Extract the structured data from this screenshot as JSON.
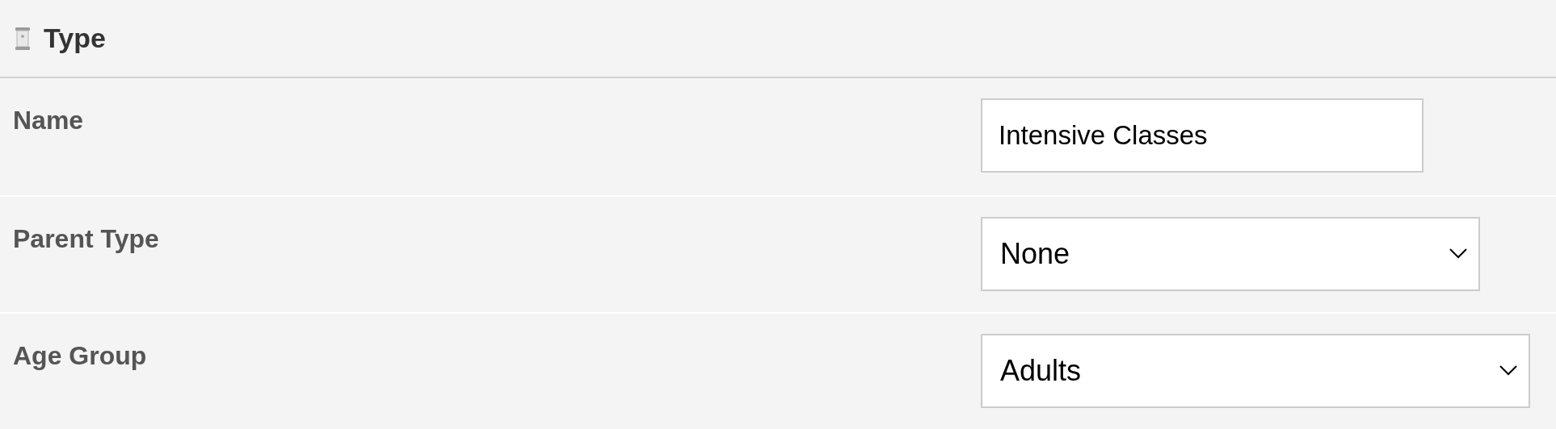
{
  "section": {
    "title": "Type"
  },
  "fields": [
    {
      "label": "Name",
      "kind": "text",
      "value": "Intensive Classes"
    },
    {
      "label": "Parent Type",
      "kind": "select",
      "value": "None"
    },
    {
      "label": "Age Group",
      "kind": "select",
      "value": "Adults"
    }
  ]
}
